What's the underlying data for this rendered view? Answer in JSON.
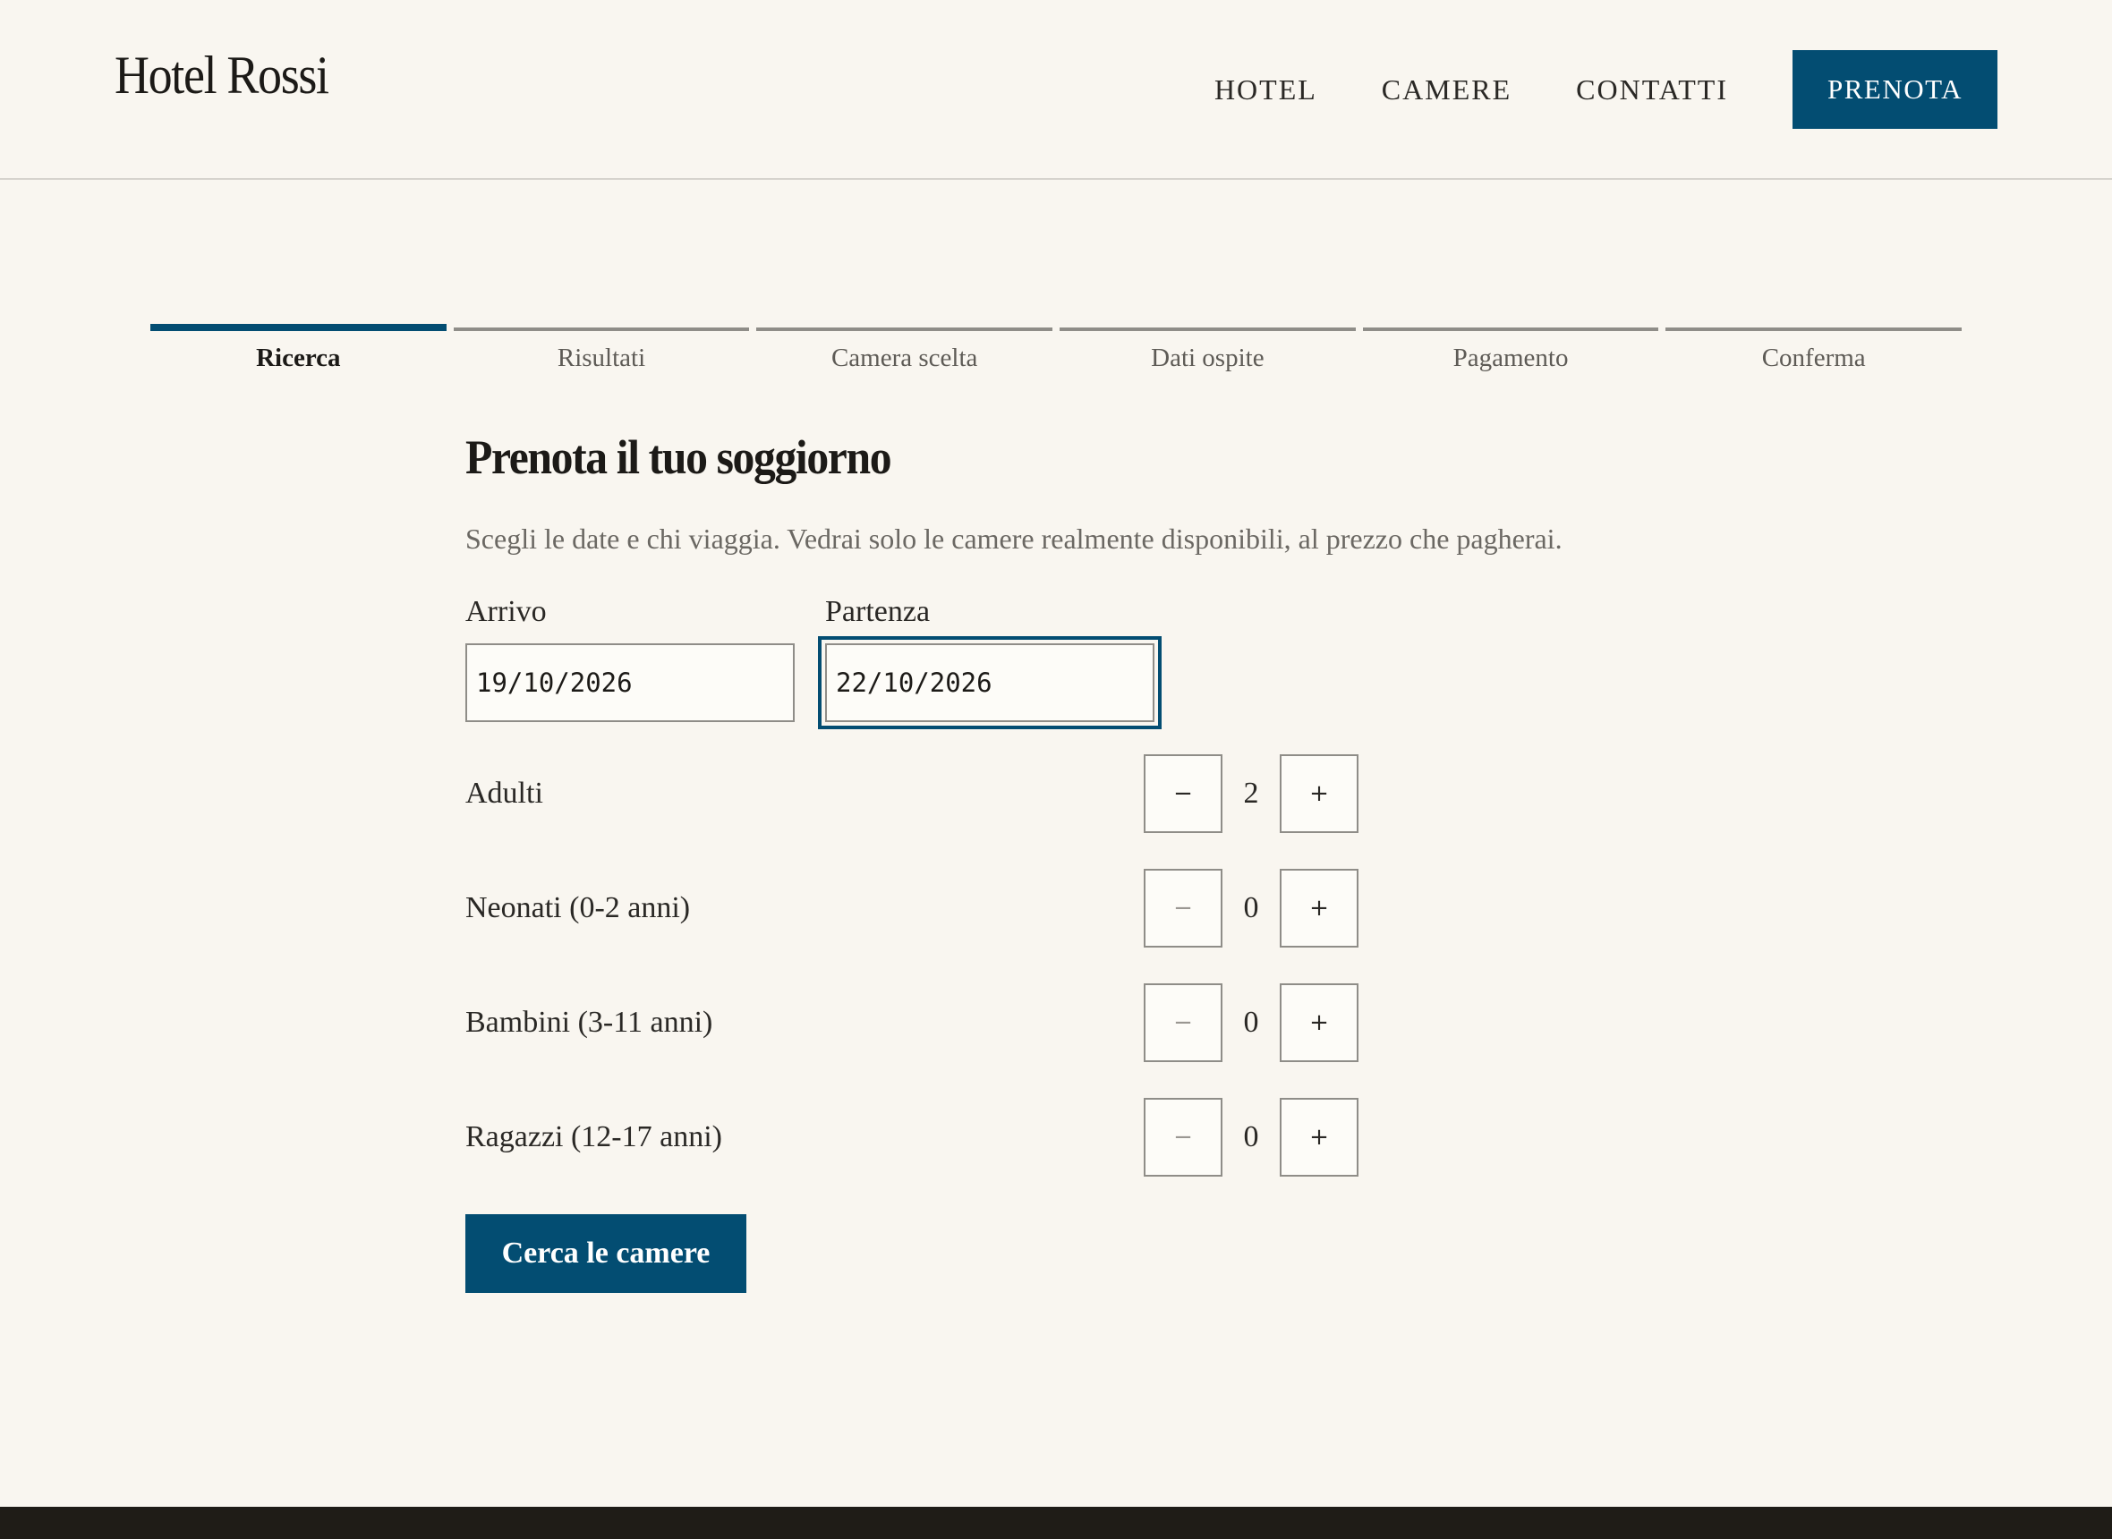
{
  "header": {
    "logo": "Hotel Rossi",
    "nav": [
      "HOTEL",
      "CAMERE",
      "CONTATTI"
    ],
    "cta": "PRENOTA"
  },
  "steps": {
    "items": [
      "Ricerca",
      "Risultati",
      "Camera scelta",
      "Dati ospite",
      "Pagamento",
      "Conferma"
    ],
    "active_index": 0
  },
  "form": {
    "title": "Prenota il tuo soggiorno",
    "subtitle": "Scegli le date e chi viaggia. Vedrai solo le camere realmente disponibili, al prezzo che pagherai.",
    "arrival": {
      "label": "Arrivo",
      "value": "19/10/2026"
    },
    "departure": {
      "label": "Partenza",
      "value": "22/10/2026"
    },
    "decrement_symbol": "−",
    "increment_symbol": "+",
    "guests": [
      {
        "label": "Adulti",
        "value": "2"
      },
      {
        "label": "Neonati (0-2 anni)",
        "value": "0"
      },
      {
        "label": "Bambini (3-11 anni)",
        "value": "0"
      },
      {
        "label": "Ragazzi (12-17 anni)",
        "value": "0"
      }
    ],
    "submit": "Cerca le camere"
  },
  "colors": {
    "accent": "#034d72",
    "background": "#f9f6f0",
    "footer": "#1f1c17"
  }
}
